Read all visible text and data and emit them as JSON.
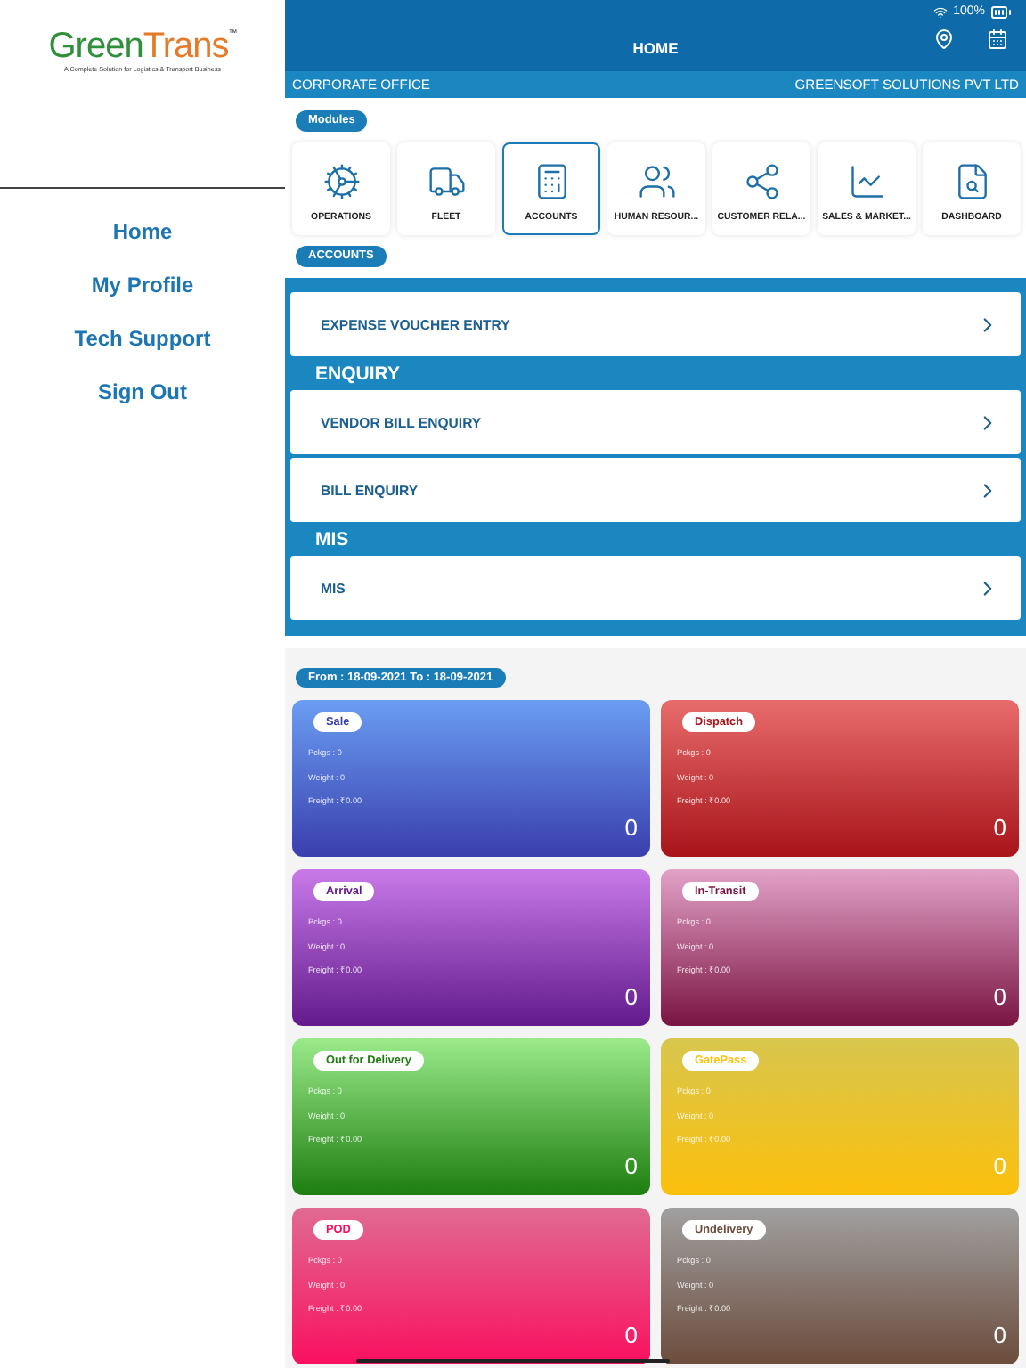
{
  "sidebar": {
    "logo": {
      "first": "Green",
      "second": "Trans",
      "mark": "™",
      "tagline": "A Complete Solution for Logistics & Transport Business"
    },
    "items": [
      {
        "label": "Home"
      },
      {
        "label": "My Profile"
      },
      {
        "label": "Tech Support"
      },
      {
        "label": "Sign Out"
      }
    ]
  },
  "status_bar": {
    "battery": "100%"
  },
  "header": {
    "title": "HOME"
  },
  "subheader": {
    "left": "CORPORATE OFFICE",
    "right": "GREENSOFT SOLUTIONS PVT LTD"
  },
  "modules": {
    "label": "Modules",
    "items": [
      {
        "label": "OPERATIONS",
        "selected": false
      },
      {
        "label": "FLEET",
        "selected": false
      },
      {
        "label": "ACCOUNTS",
        "selected": true
      },
      {
        "label": "HUMAN RESOUR...",
        "selected": false
      },
      {
        "label": "CUSTOMER RELA...",
        "selected": false
      },
      {
        "label": "SALES & MARKET...",
        "selected": false
      },
      {
        "label": "DASHBOARD",
        "selected": false
      }
    ]
  },
  "accounts": {
    "label": "ACCOUNTS",
    "entries": [
      {
        "kind": "item",
        "label": "EXPENSE VOUCHER ENTRY"
      },
      {
        "kind": "section",
        "label": "ENQUIRY"
      },
      {
        "kind": "item",
        "label": "VENDOR BILL ENQUIRY"
      },
      {
        "kind": "item",
        "label": "BILL ENQUIRY"
      },
      {
        "kind": "section",
        "label": "MIS"
      },
      {
        "kind": "item",
        "label": "MIS"
      }
    ]
  },
  "date_range": "From : 18-09-2021 To : 18-09-2021",
  "cards": [
    {
      "label": "Sale",
      "color": "#6a9df2",
      "pckgs": "Pckgs : 0",
      "weight": "Weight : 0",
      "freight": "Freight : ₹0.00",
      "count": "0"
    },
    {
      "label": "Dispatch",
      "color": "#e86c6c",
      "pckgs": "Pckgs : 0",
      "weight": "Weight : 0",
      "freight": "Freight : ₹0.00",
      "count": "0"
    },
    {
      "label": "Arrival",
      "color": "#c87ae8",
      "pckgs": "Pckgs : 0",
      "weight": "Weight : 0",
      "freight": "Freight : ₹0.00",
      "count": "0"
    },
    {
      "label": "In-Transit",
      "color": "#e2a2c8",
      "pckgs": "Pckgs : 0",
      "weight": "Weight : 0",
      "freight": "Freight : ₹0.00",
      "count": "0"
    },
    {
      "label": "Out for Delivery",
      "color": "#9aea8a",
      "pckgs": "Pckgs : 0",
      "weight": "Weight : 0",
      "freight": "Freight : ₹0.00",
      "count": "0"
    },
    {
      "label": "GatePass",
      "color": "#d8c64e",
      "pckgs": "Pckgs : 0",
      "weight": "Weight : 0",
      "freight": "Freight : ₹0.00",
      "count": "0"
    },
    {
      "label": "POD",
      "color": "#e06a92",
      "pckgs": "Pckgs : 0",
      "weight": "Weight : 0",
      "freight": "Freight : ₹0.00",
      "count": "0"
    },
    {
      "label": "Undelivery",
      "color": "#a0a0a0",
      "pckgs": "Pckgs : 0",
      "weight": "Weight : 0",
      "freight": "Freight : ₹0.00",
      "count": "0"
    }
  ]
}
